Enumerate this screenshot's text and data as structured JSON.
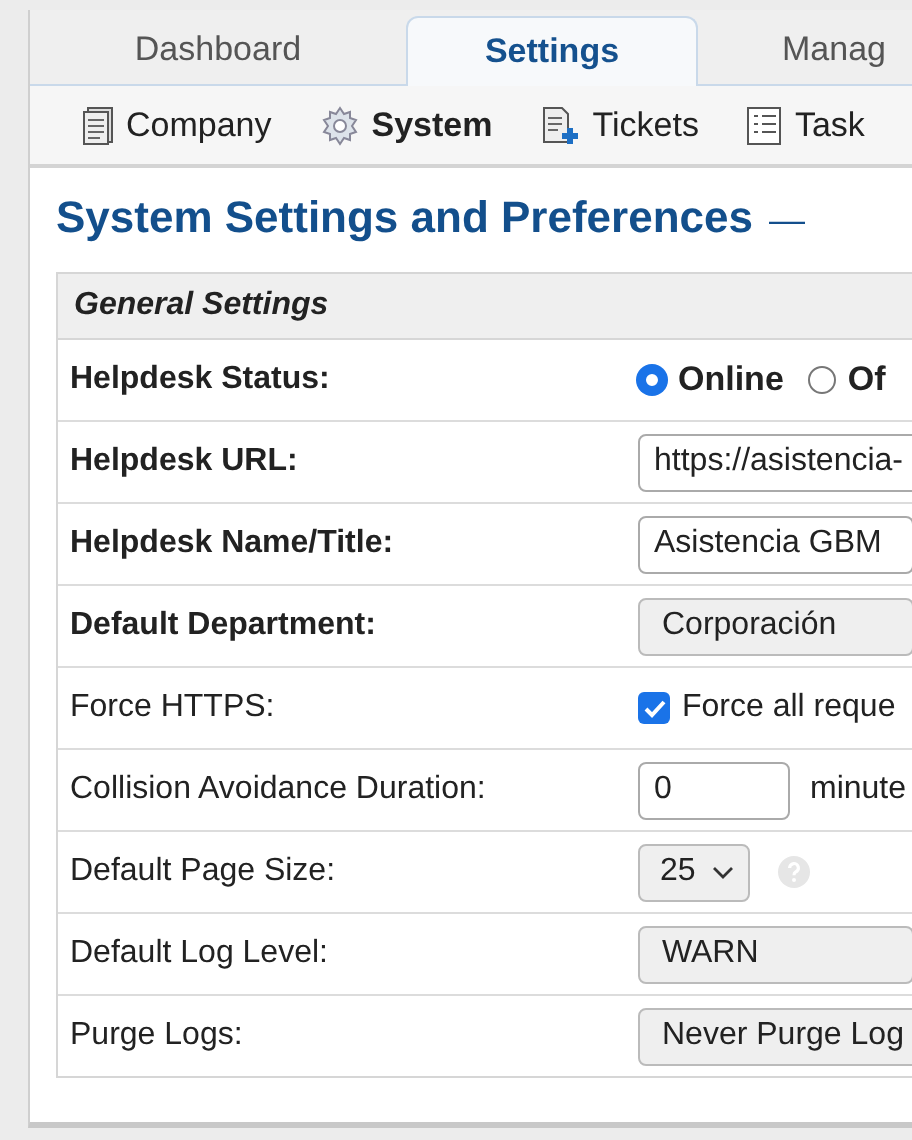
{
  "tabs": [
    {
      "label": "Dashboard",
      "selected": false
    },
    {
      "label": "Settings",
      "selected": true
    },
    {
      "label": "Manag",
      "selected": false
    }
  ],
  "subnav": [
    {
      "label": "Company",
      "kind": "document",
      "selected": false
    },
    {
      "label": "System",
      "kind": "gear",
      "selected": true
    },
    {
      "label": "Tickets",
      "kind": "ticket",
      "selected": false
    },
    {
      "label": "Task",
      "kind": "list",
      "selected": false
    }
  ],
  "title": "System Settings and Preferences",
  "title_suffix": "—",
  "section": "General Settings",
  "rows": [
    {
      "label": "Helpdesk Status:",
      "bold": true,
      "kind": "radio",
      "options": [
        {
          "label": "Online",
          "selected": true
        },
        {
          "label": "Of",
          "selected": false
        }
      ]
    },
    {
      "label": "Helpdesk URL:",
      "bold": true,
      "kind": "text",
      "value": "https://asistencia-"
    },
    {
      "label": "Helpdesk Name/Title:",
      "bold": true,
      "kind": "text",
      "value": "Asistencia GBM"
    },
    {
      "label": "Default Department:",
      "bold": true,
      "kind": "select",
      "value": "Corporación"
    },
    {
      "label": "Force HTTPS:",
      "bold": false,
      "kind": "checkbox",
      "checked": true,
      "text": "Force all reque"
    },
    {
      "label": "Collision Avoidance Duration:",
      "bold": false,
      "kind": "number",
      "value": "0",
      "unit": "minute"
    },
    {
      "label": "Default Page Size:",
      "bold": false,
      "kind": "small_select",
      "value": "25"
    },
    {
      "label": "Default Log Level:",
      "bold": false,
      "kind": "select",
      "value": "WARN"
    },
    {
      "label": "Purge Logs:",
      "bold": false,
      "kind": "select",
      "value": "Never Purge Log"
    }
  ]
}
